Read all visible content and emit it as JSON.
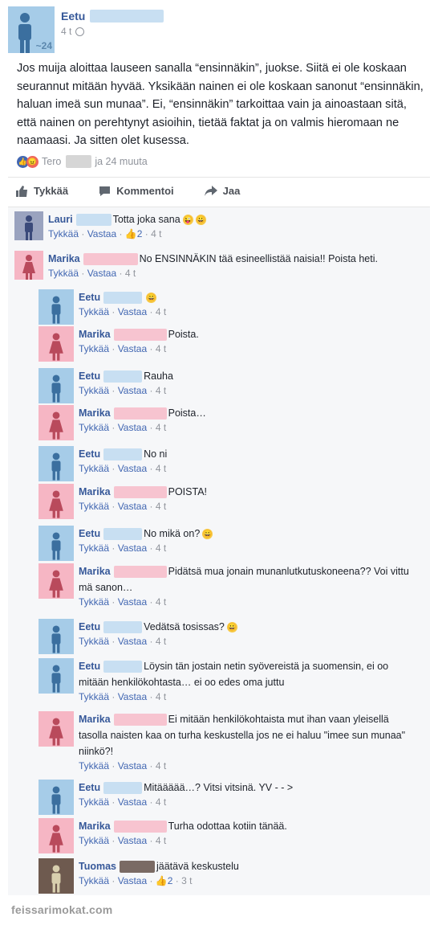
{
  "post": {
    "author": "Eetu",
    "avatar_age": "~24",
    "time": "4 t",
    "text": "Jos muija aloittaa lauseen sanalla “ensinnäkin”, juokse. Siitä ei ole koskaan seurannut mitään hyvää. Yksikään nainen ei ole koskaan sanonut “ensinnäkin, haluan imeä sun munaa”. Ei, “ensinnäkin” tarkoittaa vain ja ainoastaan sitä, että nainen on perehtynyt asioihin, tietää faktat ja on valmis hieromaan ne naamaasi. Ja sitten olet kusessa.",
    "reactions_name": "Tero",
    "reactions_rest": "ja 24 muuta"
  },
  "actions": {
    "like": "Tykkää",
    "comment": "Kommentoi",
    "share": "Jaa"
  },
  "comment_actions": {
    "like": "Tykkää",
    "reply": "Vastaa"
  },
  "comments": [
    {
      "name": "Lauri",
      "text": "Totta joka sana",
      "emoji": "😜😀",
      "likes": "2",
      "time": "4 t",
      "color": "#9aa3bf"
    },
    {
      "name": "Marika",
      "text": "No ENSINNÄKIN tää esineellistää naisia!! Poista heti.",
      "time": "4 t",
      "color": "#f6b6c4"
    },
    {
      "name": "Eetu",
      "text": "",
      "emoji": "😀",
      "time": "4 t",
      "color": "#a6cce8"
    },
    {
      "name": "Marika",
      "text": "Poista.",
      "time": "4 t",
      "color": "#f6b6c4"
    },
    {
      "name": "Eetu",
      "text": "Rauha",
      "time": "4 t",
      "color": "#a6cce8"
    },
    {
      "name": "Marika",
      "text": "Poista…",
      "time": "4 t",
      "color": "#f6b6c4"
    },
    {
      "name": "Eetu",
      "text": "No ni",
      "time": "4 t",
      "color": "#a6cce8"
    },
    {
      "name": "Marika",
      "text": "POISTA!",
      "time": "4 t",
      "color": "#f6b6c4"
    },
    {
      "name": "Eetu",
      "text": "No mikä on?",
      "emoji": "😀",
      "time": "4 t",
      "color": "#a6cce8"
    },
    {
      "name": "Marika",
      "text": "Pidätsä mua jonain munanlutkutuskoneena?? Voi vittu mä sanon…",
      "time": "4 t",
      "color": "#f6b6c4"
    },
    {
      "name": "Eetu",
      "text": "Vedätsä tosissas?",
      "emoji": "😀",
      "time": "4 t",
      "color": "#a6cce8"
    },
    {
      "name": "Eetu",
      "text": "Löysin tän jostain netin syövereistä ja suomensin, ei oo mitään henkilökohtasta… ei oo edes oma juttu",
      "time": "4 t",
      "color": "#a6cce8"
    },
    {
      "name": "Marika",
      "text": "Ei mitään henkilökohtaista mut ihan vaan yleisellä tasolla naisten kaa on turha keskustella jos ne ei haluu \"imee sun munaa\" niinkö?!",
      "time": "4 t",
      "color": "#f6b6c4"
    },
    {
      "name": "Eetu",
      "text": "Mitäääää…? Vitsi vitsinä. YV - - >",
      "time": "4 t",
      "color": "#a6cce8"
    },
    {
      "name": "Marika",
      "text": "Turha odottaa kotiin tänää.",
      "time": "4 t",
      "color": "#f6b6c4"
    },
    {
      "name": "Tuomas",
      "text": "jäätävä keskustelu",
      "likes": "2",
      "time": "3 t",
      "color": "#6e5a4f"
    }
  ],
  "watermark": "feissarimokat.com"
}
